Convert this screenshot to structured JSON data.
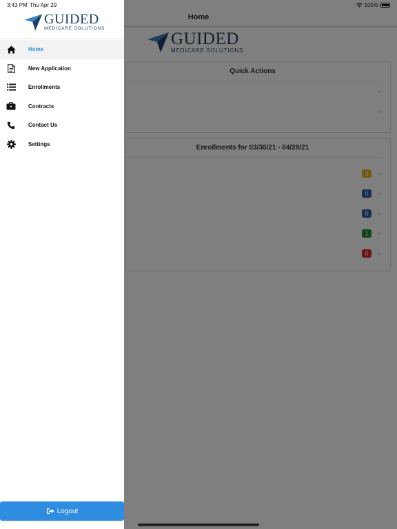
{
  "status": {
    "time": "3:43 PM",
    "date": "Thu Apr 29",
    "battery": "100%"
  },
  "nav": {
    "title": "Home"
  },
  "logo": {
    "name": "GUIDED",
    "tagline": "MEDICARE SOLUTIONS",
    "color": "#1c3f66",
    "accent": "#3a7fc1"
  },
  "quick_actions": {
    "title": "Quick Actions",
    "rows": [
      {
        "chevron": "›"
      },
      {
        "chevron": "›"
      }
    ]
  },
  "enrollments": {
    "title": "Enrollments for 03/30/21 - 04/29/21",
    "rows": [
      {
        "count": "3",
        "color": "#e6b323",
        "chevron": "›"
      },
      {
        "count": "0",
        "color": "#2c5f9e",
        "chevron": "›"
      },
      {
        "count": "0",
        "color": "#2c5f9e",
        "chevron": "›"
      },
      {
        "count": "1",
        "color": "#1f8a2e",
        "chevron": "›"
      },
      {
        "count": "0",
        "color": "#d32626",
        "chevron": "›"
      }
    ]
  },
  "drawer": {
    "menu": [
      {
        "label": "Home",
        "icon": "home-icon",
        "active": true
      },
      {
        "label": "New Application",
        "icon": "document-icon",
        "active": false
      },
      {
        "label": "Enrollments",
        "icon": "list-icon",
        "active": false
      },
      {
        "label": "Contracts",
        "icon": "briefcase-icon",
        "active": false
      },
      {
        "label": "Contact Us",
        "icon": "phone-icon",
        "active": false
      },
      {
        "label": "Settings",
        "icon": "gear-icon",
        "active": false
      }
    ],
    "logout_label": "Logout",
    "logout_color": "#2e8de0"
  }
}
